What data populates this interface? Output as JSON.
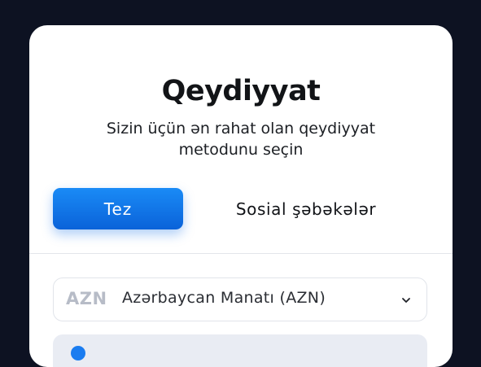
{
  "registration": {
    "title": "Qeydiyyat",
    "subtitle": "Sizin üçün ən rahat olan qeydiyyat metodunu seçin",
    "tabs": {
      "quick_label": "Tez",
      "social_label": "Sosial şəbəkələr",
      "active": "quick"
    },
    "currency": {
      "code": "AZN",
      "name": "Azərbaycan Manatı (AZN)"
    }
  },
  "colors": {
    "background": "#0d1222",
    "accent": "#0f74ec",
    "card": "#ffffff"
  }
}
